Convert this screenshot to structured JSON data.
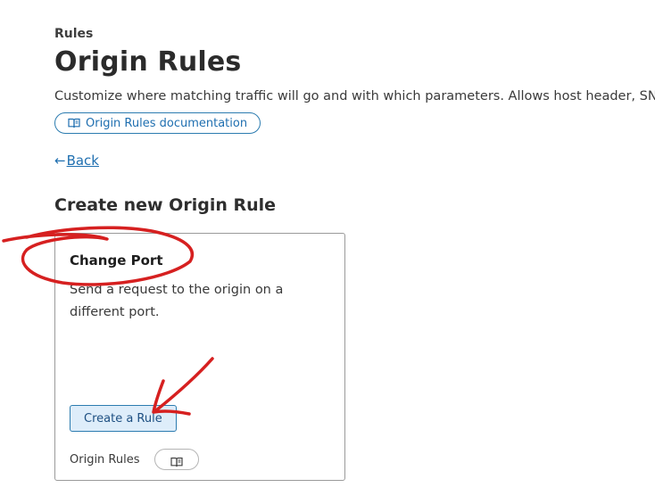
{
  "header": {
    "section": "Rules",
    "title": "Origin Rules",
    "description": "Customize where matching traffic will go and with which parameters. Allows host header, SNI, D",
    "doc_link_label": "Origin Rules documentation"
  },
  "nav": {
    "back_arrow": "←",
    "back_label": "Back"
  },
  "create": {
    "heading": "Create new Origin Rule"
  },
  "card": {
    "title": "Change Port",
    "description": "Send a request to the origin on a different port.",
    "button_label": "Create a Rule",
    "footer_label": "Origin Rules",
    "footer_icon": "book-icon"
  },
  "colors": {
    "link": "#1f6fb0",
    "button_bg": "#deedfa",
    "annotation": "#d62020"
  }
}
